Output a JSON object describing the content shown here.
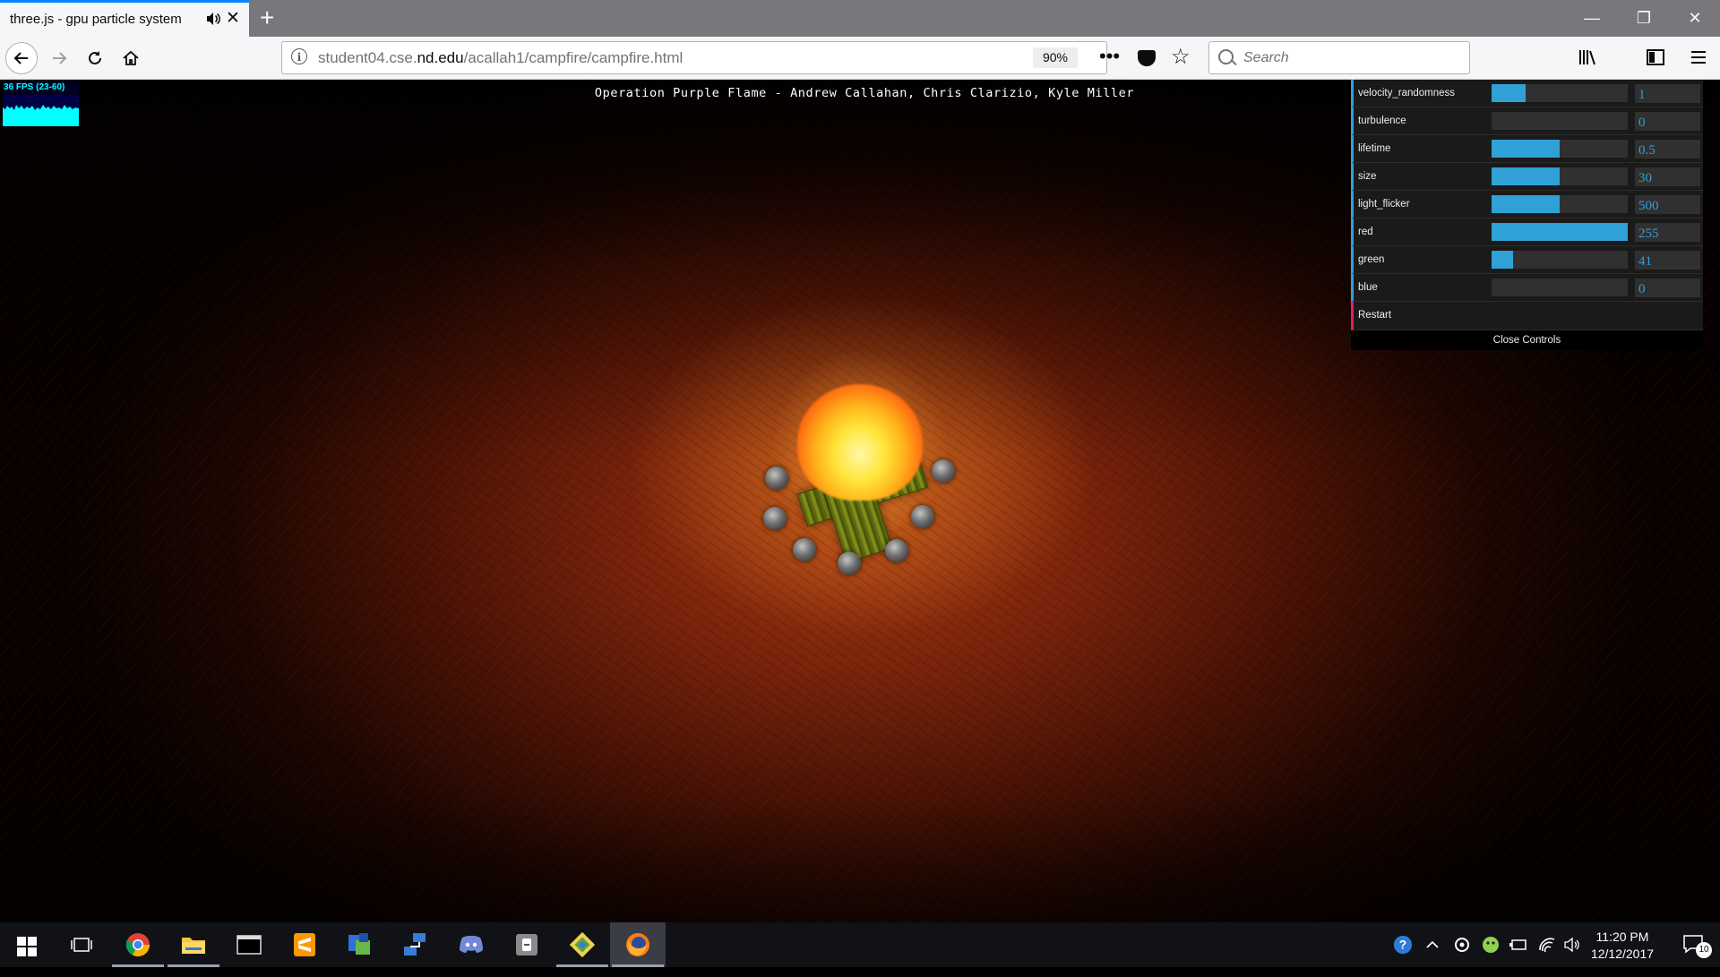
{
  "browser": {
    "tab_title": "three.js - gpu particle system",
    "tab_close": "✕",
    "new_tab": "+",
    "url_prefix": "student04.cse.",
    "url_host": "nd.edu",
    "url_path": "/acallah1/campfire/campfire.html",
    "zoom": "90%",
    "page_actions": "•••",
    "search_placeholder": "Search",
    "window_controls": [
      "—",
      "❐",
      "✕"
    ]
  },
  "page": {
    "title": "Operation Purple Flame - Andrew Callahan, Chris Clarizio, Kyle Miller",
    "fps_label": "36 FPS (23-60)"
  },
  "gui": {
    "controls": [
      {
        "label": "velocity_randomness",
        "value": "1",
        "fill": 0.25
      },
      {
        "label": "turbulence",
        "value": "0",
        "fill": 0.0
      },
      {
        "label": "lifetime",
        "value": "0.5",
        "fill": 0.5
      },
      {
        "label": "size",
        "value": "30",
        "fill": 0.5
      },
      {
        "label": "light_flicker",
        "value": "500",
        "fill": 0.5
      },
      {
        "label": "red",
        "value": "255",
        "fill": 1.0
      },
      {
        "label": "green",
        "value": "41",
        "fill": 0.16
      },
      {
        "label": "blue",
        "value": "0",
        "fill": 0.0
      }
    ],
    "restart_label": "Restart",
    "close_label": "Close Controls"
  },
  "taskbar": {
    "time": "11:20 PM",
    "date": "12/12/2017",
    "notification_count": "10",
    "apps": [
      "task-view",
      "chrome",
      "file-explorer",
      "terminal",
      "sublime-text",
      "windows-security",
      "network-tool",
      "discord",
      "ssh-client",
      "git-client",
      "firefox"
    ]
  },
  "colors": {
    "gui_accent": "#2fa1d6",
    "gui_button_accent": "#e61d5f",
    "fps_text": "#00ffff",
    "firefox_tab_accent": "#0a84ff"
  }
}
